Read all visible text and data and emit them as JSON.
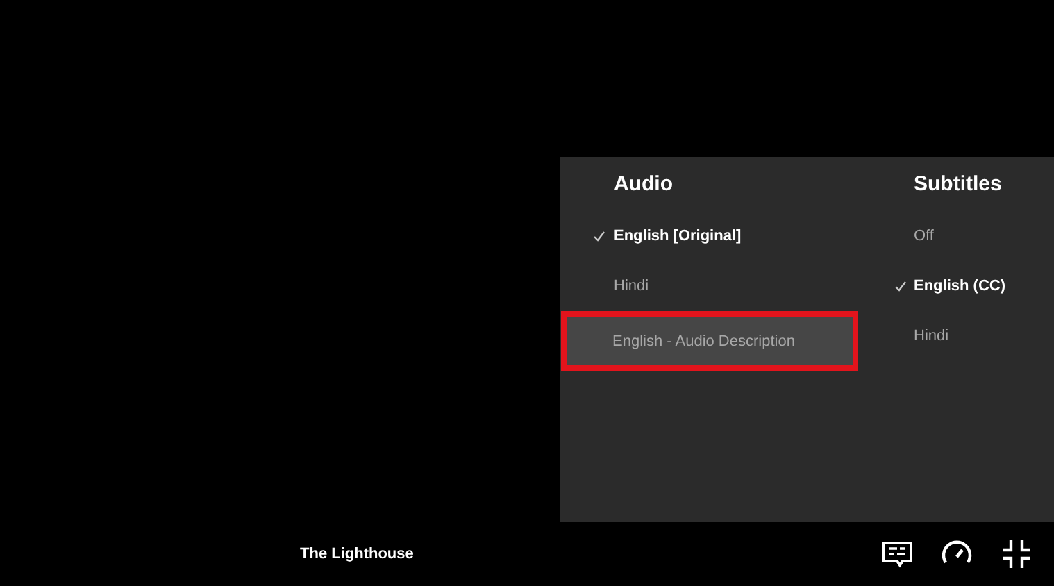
{
  "menu": {
    "columns": [
      {
        "heading": "Audio",
        "items": [
          {
            "label": "English [Original]",
            "selected": true,
            "highlighted": false
          },
          {
            "label": "Hindi",
            "selected": false,
            "highlighted": false
          },
          {
            "label": "English - Audio Description",
            "selected": false,
            "highlighted": true
          }
        ]
      },
      {
        "heading": "Subtitles",
        "items": [
          {
            "label": "Off",
            "selected": false,
            "highlighted": false
          },
          {
            "label": "English (CC)",
            "selected": true,
            "highlighted": false
          },
          {
            "label": "Hindi",
            "selected": false,
            "highlighted": false
          }
        ]
      }
    ]
  },
  "title": "The Lighthouse"
}
